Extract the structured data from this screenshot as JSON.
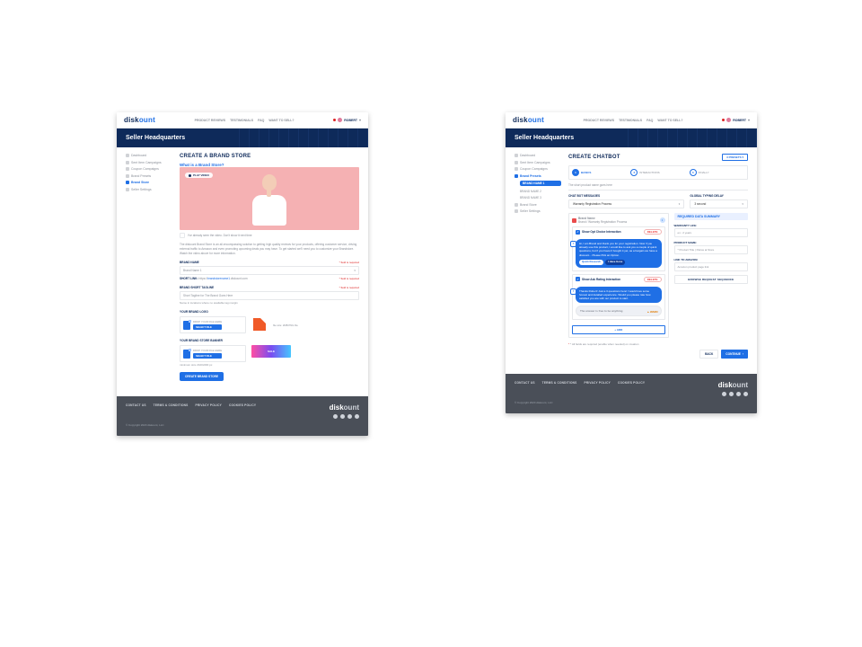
{
  "brand": {
    "pre": "disk",
    "accent": "ount"
  },
  "topnav": [
    "PRODUCT REVIEWS",
    "TESTIMONIALS",
    "FAQ",
    "WANT TO SELL?"
  ],
  "user": {
    "name": "ROBERT"
  },
  "hero": "Seller Headquarters",
  "sidebar": {
    "items": [
      {
        "label": "Dashboard"
      },
      {
        "label": "Sent Item Campaigns"
      },
      {
        "label": "Coupon Campaigns"
      },
      {
        "label": "Brand Presets"
      },
      {
        "label": "Brand Store"
      },
      {
        "label": "Seller Settings"
      }
    ]
  },
  "sidebarB": {
    "items": [
      {
        "label": "Dashboard"
      },
      {
        "label": "Sent Item Campaigns"
      },
      {
        "label": "Coupon Campaigns"
      },
      {
        "label": "Brand Presets"
      },
      {
        "label": "Brand Store"
      },
      {
        "label": "Seller Settings"
      }
    ],
    "subs": [
      "BRAND NAME 1",
      "BRAND NAME 2",
      "BRAND NAME 3"
    ]
  },
  "a": {
    "title": "CREATE A BRAND STORE",
    "subtitle": "What is a Brand Store?",
    "play": "PLAY VIDEO",
    "seen": "I've already seen the video. Don't show it next time",
    "para": "The diskount Brand Store is an all-encompassing solution to getting high quality reviews for your products, offering customer service, driving external traffic to Amazon and even promoting upcoming deals you may have. To get started we'll need you to customize your Brandstore. Watch the video above for more information.",
    "brandname_label": "BRAND NAME",
    "brandname_req": "* field is required",
    "brandname_value": "Brand Name 1",
    "shortlink_label": "SHORT LINK:",
    "shortlink_pre": "https://",
    "shortlink_mid": "brandstorename1",
    "shortlink_post": ".diskount.com",
    "shortlink_req": "* field is required",
    "tagline_label": "BRAND SHORT TAGLINE",
    "tagline_req": "* field is required",
    "tagline_placeholder": "Short Tagline for The Brand Goes Here",
    "tagline_helper": "Name in locations where no available tag margin",
    "logo_label": "YOUR BRAND LOGO",
    "upload_drop": "DROP YOUR FILE HERE",
    "upload_btn": "SELECT FILE",
    "logo_meta": "file size: 2MB PNG file",
    "banner_label": "YOUR BRAND STORE BANNER",
    "banner_text": "SALE",
    "minsize": "minimum size 2100x600 px",
    "cta": "CREATE BRAND STORE"
  },
  "b": {
    "title": "CREATE CHATBOT",
    "preset": "3 PRESETS",
    "steps": [
      "BASICS",
      "INTERACTIONS",
      "FINALLY"
    ],
    "subnote": "The short product name goes here",
    "chatmsg_label": "CHAT BOT MESSAGES",
    "chatmsg_value": "Warranty Registration Process",
    "delay_label": "GLOBAL TYPING DELAY",
    "delay_value": "3 second",
    "brandname_row": "Brand Name",
    "brandname_sub": "Brand / Warranty Registration Process",
    "block1_title": "Show  Opt Choice Interaction",
    "del": "DELETE",
    "bubble1": "Hi, I am Brand and thank you for your registration. Now if you already use this product, I would like to ask you a couple of quick questions, but if you haven't bought it yet, as a bargain we have a discount... Please Pick an Option.",
    "chip1": "Quick Research",
    "chip2": "I Have Gone",
    "block2_title": "Show  Ask Rating Interaction",
    "bubble2": "Thanks Robert! Just a 3 questions here! I would love some honest and detailed experience. Would you please rate how satisfied you are with our product to start.",
    "bubble_user": "The answer is free to be anything",
    "warn": "WARN",
    "add": "+ ADD",
    "rq_head": "REQUIRED DATA SUMMARY",
    "rq_warranty_l": "WARRANTY LIFE:",
    "rq_warranty_v": "ex.: 2 years",
    "rq_product_l": "PRODUCT NAME:",
    "rq_product_v": "* Product Title | Patios at Store",
    "rq_link_l": "LINK TO AMAZON:",
    "rq_link_v": "Amazon product page link",
    "rq_btn": "BROWSE REQUEST SEQUENCE",
    "hint": "* All fields are required (enable when needed) on creation",
    "back": "BACK",
    "continue": "CONTINUE"
  },
  "footer": {
    "links": [
      "CONTACT US",
      "TERMS & CONDITIONS",
      "PRIVACY POLICY",
      "COOKIES POLICY"
    ],
    "copyright": "© Copyright 2020 diskount, LLC"
  }
}
